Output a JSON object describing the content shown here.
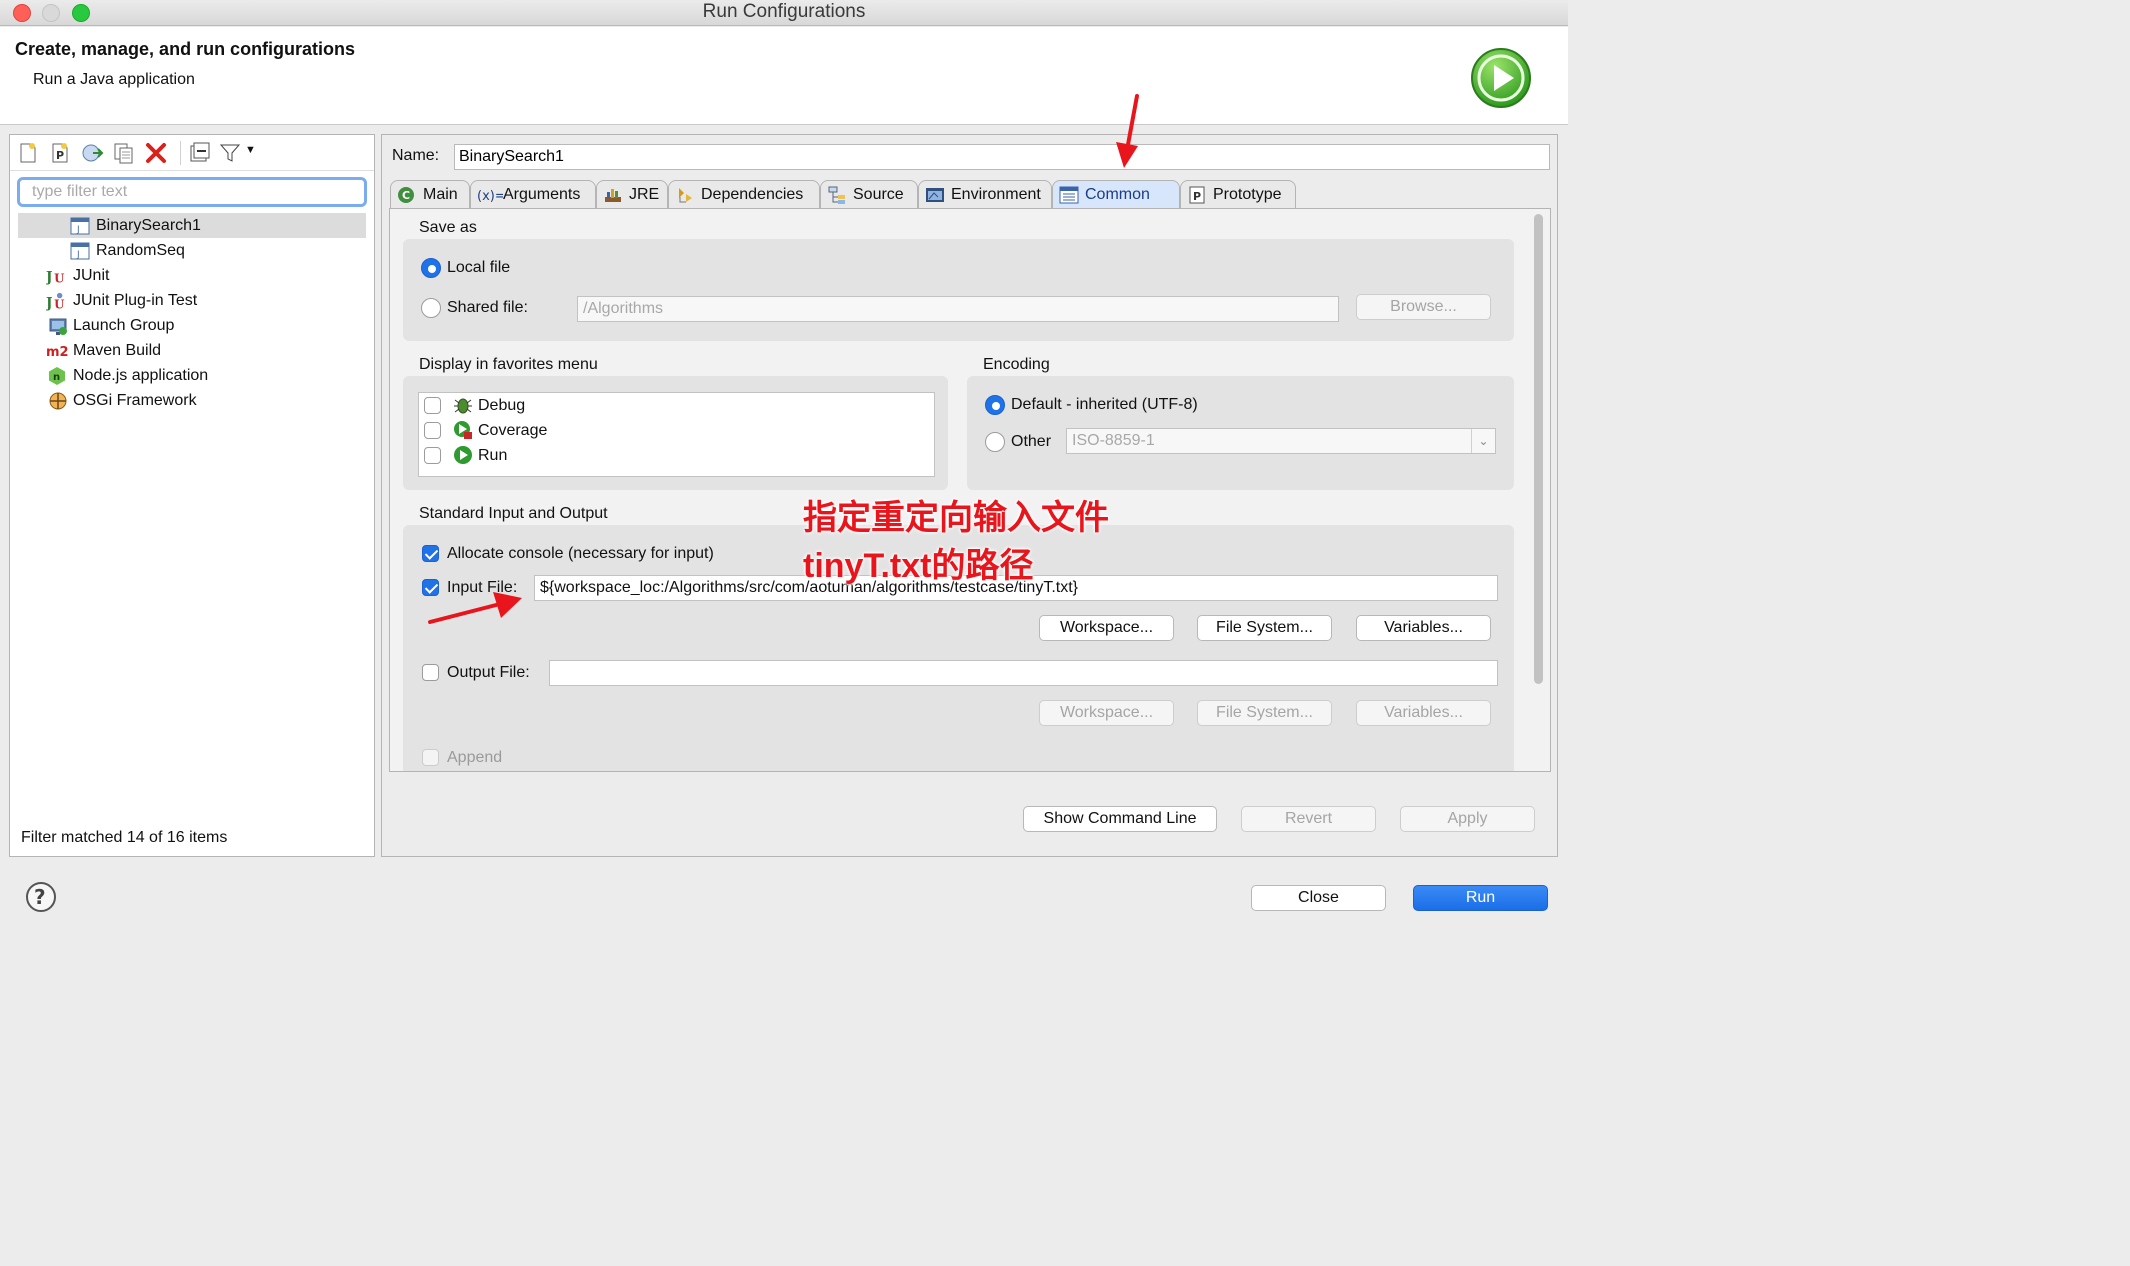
{
  "window": {
    "title": "Run Configurations",
    "traffic_lights": {
      "close": "#fe5f57",
      "minimize": "#febc2e",
      "zoom": "#28c840"
    }
  },
  "header": {
    "title": "Create, manage, and run configurations",
    "subtitle": "Run a Java application",
    "icon": "run-circle-icon"
  },
  "left": {
    "toolbar_icons": [
      "new-config-icon",
      "new-prototype-icon",
      "export-icon",
      "duplicate-icon",
      "delete-icon",
      "collapse-all-icon",
      "filter-icon",
      "dropdown-arrow-icon"
    ],
    "filter_placeholder": "type filter text",
    "tree": [
      {
        "label": "BinarySearch1",
        "icon": "java-app-icon",
        "indent": 1,
        "selected": true
      },
      {
        "label": "RandomSeq",
        "icon": "java-app-icon",
        "indent": 1,
        "selected": false
      },
      {
        "label": "JUnit",
        "icon": "junit-icon",
        "indent": 0,
        "selected": false
      },
      {
        "label": "JUnit Plug-in Test",
        "icon": "junit-plugin-icon",
        "indent": 0,
        "selected": false
      },
      {
        "label": "Launch Group",
        "icon": "launch-group-icon",
        "indent": 0,
        "selected": false
      },
      {
        "label": "Maven Build",
        "icon": "maven-icon",
        "indent": 0,
        "selected": false
      },
      {
        "label": "Node.js application",
        "icon": "nodejs-icon",
        "indent": 0,
        "selected": false
      },
      {
        "label": "OSGi Framework",
        "icon": "osgi-icon",
        "indent": 0,
        "selected": false
      }
    ],
    "status": "Filter matched 14 of 16 items"
  },
  "right": {
    "name_label": "Name:",
    "name_value": "BinarySearch1",
    "tabs": [
      {
        "label": "Main",
        "icon": "main-tab-icon",
        "active": false
      },
      {
        "label": "Arguments",
        "icon": "arguments-tab-icon",
        "active": false
      },
      {
        "label": "JRE",
        "icon": "jre-tab-icon",
        "active": false
      },
      {
        "label": "Dependencies",
        "icon": "dependencies-tab-icon",
        "active": false
      },
      {
        "label": "Source",
        "icon": "source-tab-icon",
        "active": false
      },
      {
        "label": "Environment",
        "icon": "environment-tab-icon",
        "active": false
      },
      {
        "label": "Common",
        "icon": "common-tab-icon",
        "active": true
      },
      {
        "label": "Prototype",
        "icon": "prototype-tab-icon",
        "active": false
      }
    ],
    "save_as": {
      "title": "Save as",
      "local_label": "Local file",
      "shared_label": "Shared file:",
      "shared_value": "/Algorithms",
      "browse_label": "Browse..."
    },
    "favorites": {
      "title": "Display in favorites menu",
      "items": [
        {
          "label": "Debug",
          "icon": "debug-icon",
          "checked": false
        },
        {
          "label": "Coverage",
          "icon": "coverage-icon",
          "checked": false
        },
        {
          "label": "Run",
          "icon": "run-icon",
          "checked": false
        }
      ]
    },
    "encoding": {
      "title": "Encoding",
      "default_label": "Default - inherited (UTF-8)",
      "other_label": "Other",
      "other_value": "ISO-8859-1"
    },
    "stdio": {
      "title": "Standard Input and Output",
      "allocate_label": "Allocate console (necessary for input)",
      "input_label": "Input File:",
      "input_value": "${workspace_loc:/Algorithms/src/com/aotuman/algorithms/testcase/tinyT.txt}",
      "workspace_label": "Workspace...",
      "filesystem_label": "File System...",
      "variables_label": "Variables...",
      "output_label": "Output File:",
      "output_value": "",
      "append_label": "Append"
    },
    "buttons": {
      "show_command_line": "Show Command Line",
      "revert": "Revert",
      "apply": "Apply"
    }
  },
  "footer": {
    "help_icon": "help-icon",
    "close": "Close",
    "run": "Run"
  },
  "annotation": {
    "line1": "指定重定向输入文件",
    "line2": "tinyT.txt的路径",
    "color": "#e8161c"
  }
}
